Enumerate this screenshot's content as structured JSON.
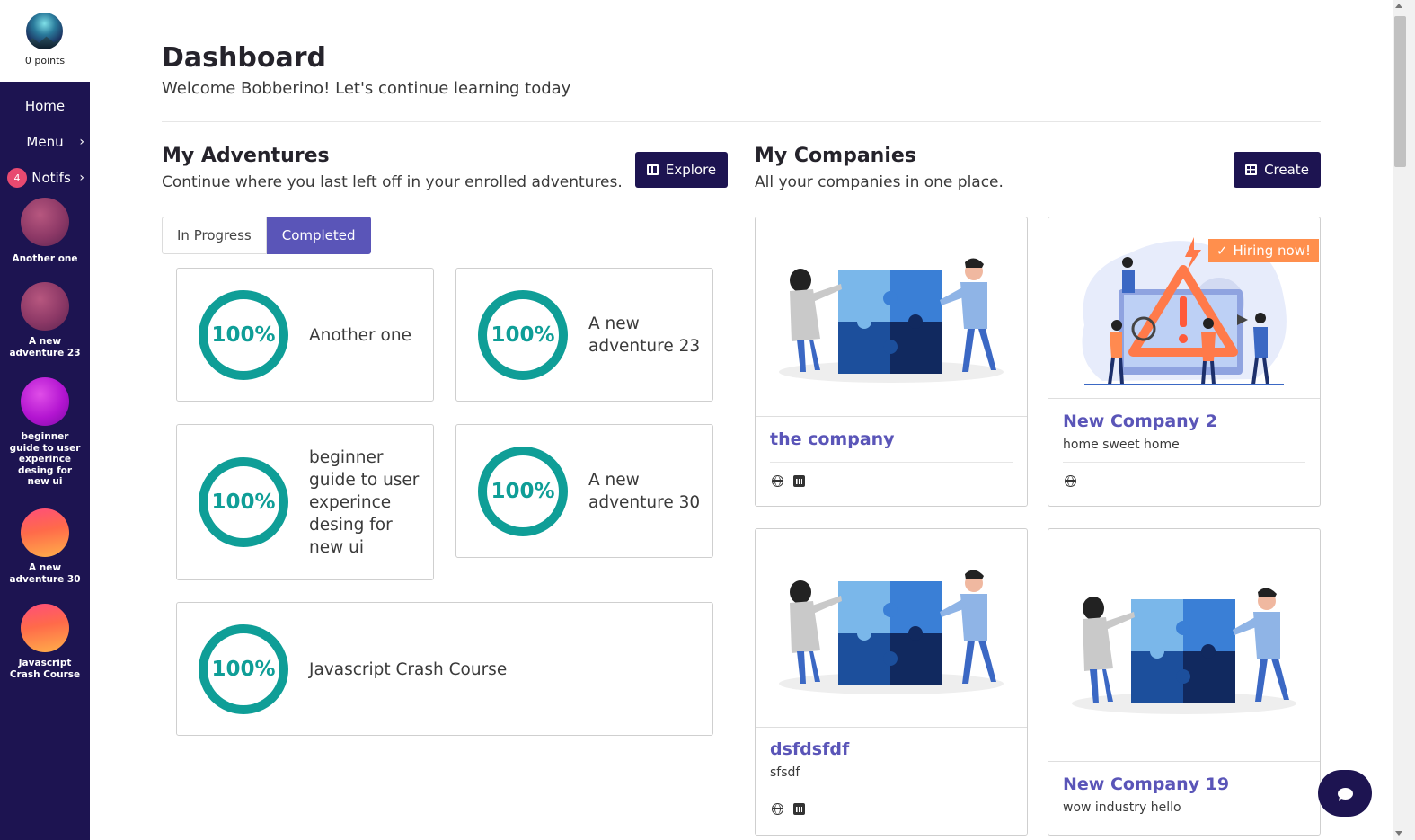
{
  "sidebar": {
    "points": "0 points",
    "nav": [
      {
        "label": "Home"
      },
      {
        "label": "Menu"
      },
      {
        "label": "Notifs",
        "badge": "4"
      }
    ],
    "adventures": [
      {
        "label": "Another one",
        "color": "#8c3866"
      },
      {
        "label": "A new adventure 23",
        "color": "#8c3866"
      },
      {
        "label": "beginner guide to user experince desing for new ui",
        "color": "#b315d1"
      },
      {
        "label": "A new adventure 30",
        "color": "#ff6a4a"
      },
      {
        "label": "Javascript Crash Course",
        "color": "#ff6a4a"
      }
    ]
  },
  "header": {
    "title": "Dashboard",
    "subtitle": "Welcome Bobberino! Let's continue learning today"
  },
  "adventures_section": {
    "title": "My Adventures",
    "subtitle": "Continue where you last left off in your enrolled adventures.",
    "explore_label": "Explore",
    "tabs": [
      {
        "label": "In Progress"
      },
      {
        "label": "Completed"
      }
    ],
    "active_tab": "Completed",
    "cards": [
      {
        "progress": "100%",
        "name": "Another one"
      },
      {
        "progress": "100%",
        "name": "A new adventure 23"
      },
      {
        "progress": "100%",
        "name": "beginner guide to user experince desing for new ui"
      },
      {
        "progress": "100%",
        "name": "A new adventure 30"
      },
      {
        "progress": "100%",
        "name": "Javascript Crash Course"
      }
    ]
  },
  "companies_section": {
    "title": "My Companies",
    "subtitle": "All your companies in one place.",
    "create_label": "Create",
    "hiring_label": "Hiring now!",
    "companies": [
      {
        "name": "the company",
        "description": "",
        "icons": [
          "globe-icon",
          "linkedin-icon"
        ]
      },
      {
        "name": "New Company 2",
        "description": "home sweet home",
        "icons": [
          "globe-icon"
        ],
        "hiring": true
      },
      {
        "name": "dsfdsfdf",
        "description": "sfsdf",
        "icons": [
          "globe-icon",
          "linkedin-icon"
        ]
      },
      {
        "name": "New Company 19",
        "description": "wow industry hello",
        "icons": []
      }
    ]
  },
  "colors": {
    "sidebar_bg": "#1d1451",
    "accent": "#5a55b8",
    "progress_ring": "#0f9e97",
    "hiring_badge": "#ff8f4d",
    "notif_badge": "#e84a70"
  }
}
